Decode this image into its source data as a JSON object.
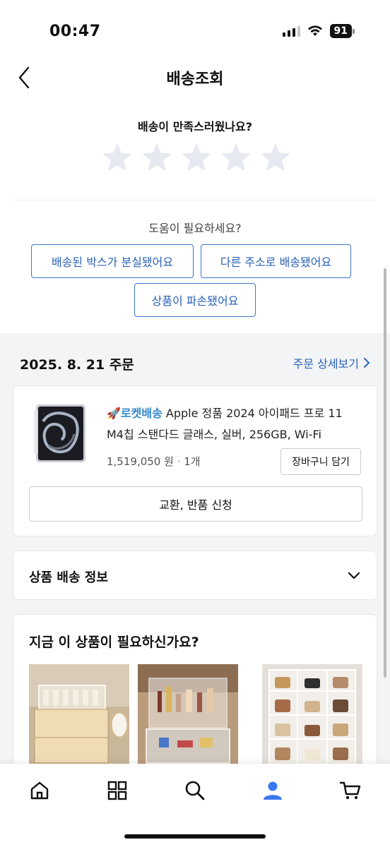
{
  "status_bar": {
    "time": "00:47",
    "battery": "91"
  },
  "nav": {
    "title": "배송조회"
  },
  "rating": {
    "question": "배송이 만족스러웠나요?",
    "stars": 5,
    "selected": 0
  },
  "help": {
    "question": "도움이 필요하세요?",
    "buttons": [
      "배송된 박스가 분실됐어요",
      "다른 주소로 배송됐어요",
      "상품이 파손됐어요"
    ]
  },
  "order": {
    "date": "2025. 8. 21 주문",
    "detail_link": "주문 상세보기",
    "product": {
      "badge": "로켓배송",
      "name": "Apple 정품 2024 아이패드 프로 11 M4칩 스탠다드 글래스, 실버, 256GB, Wi-Fi",
      "price": "1,519,050 원",
      "quantity": "1개"
    },
    "cart_button": "장바구니 담기",
    "return_button": "교환, 반품 신청"
  },
  "shipping_info": {
    "title": "상품 배송 정보"
  },
  "recommend": {
    "title": "지금 이 상품이 필요하신가요?"
  },
  "tabs": [
    "home-icon",
    "category-grid-icon",
    "search-icon",
    "my-account-icon",
    "cart-icon"
  ],
  "colors": {
    "accent": "#2a62b8",
    "rocket": "#3388cc",
    "active_tab": "#3a78f0",
    "star": "#e6e9ef"
  }
}
